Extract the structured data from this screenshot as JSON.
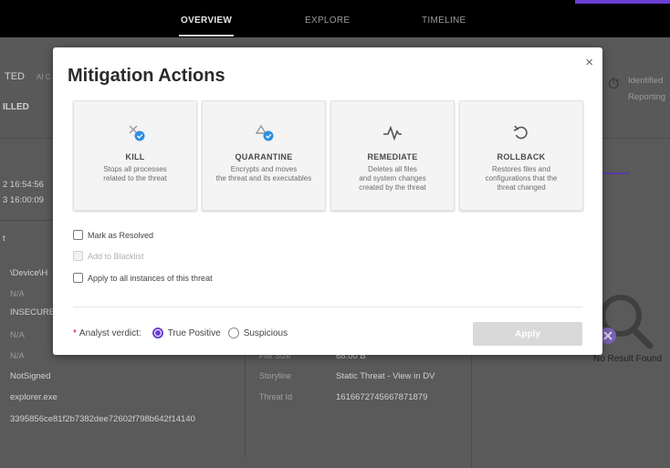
{
  "nav": {
    "tabs": [
      {
        "label": "OVERVIEW"
      },
      {
        "label": "EXPLORE"
      },
      {
        "label": "TIMELINE"
      }
    ]
  },
  "background": {
    "status_partial": "TED",
    "ai_partial": "AI C",
    "killed_partial": "ILLED",
    "identified": "Identified",
    "reporting": "Reporting",
    "time1": "2 16:54:56",
    "time2": "3 16:00:09",
    "t_partial": "t",
    "device_partial": "\\Device\\H",
    "na1": "N/A",
    "insecure": "INSECURE",
    "na2": "N/A",
    "na3": "N/A",
    "not_signed": "NotSigned",
    "explorer": "explorer.exe",
    "hash": "3395856ce81f2b7382dee72602f798b642f14140",
    "file_size_label": "File Size",
    "file_size_value": "68.00 B",
    "storyline_label": "Storyline",
    "storyline_value": "Static Threat - View in DV",
    "threat_id_label": "Threat Id",
    "threat_id_value": "1616672745667871879",
    "no_result": "No Result Found"
  },
  "modal": {
    "title": "Mitigation Actions",
    "close": "×",
    "actions": [
      {
        "name": "KILL",
        "line1": "Stops all processes",
        "line2": "related to the threat",
        "line3": ""
      },
      {
        "name": "QUARANTINE",
        "line1": "Encrypts and moves",
        "line2": "the threat and its executables",
        "line3": ""
      },
      {
        "name": "REMEDIATE",
        "line1": "Deletes all files",
        "line2": "and system changes",
        "line3": "created by the threat"
      },
      {
        "name": "ROLLBACK",
        "line1": "Restores files and",
        "line2": "configurations that the",
        "line3": "threat changed"
      }
    ],
    "options": {
      "mark_resolved": "Mark as Resolved",
      "add_blacklist": "Add to Blacklist",
      "apply_all": "Apply to all instances of this threat"
    },
    "verdict": {
      "required_mark": "*",
      "label": "Analyst verdict:",
      "true_positive": "True Positive",
      "suspicious": "Suspicious",
      "selected": "True Positive"
    },
    "apply_label": "Apply"
  },
  "colors": {
    "accent": "#6b3fd6",
    "kill_badge": "#2f8fe0",
    "required": "#d0021b"
  }
}
